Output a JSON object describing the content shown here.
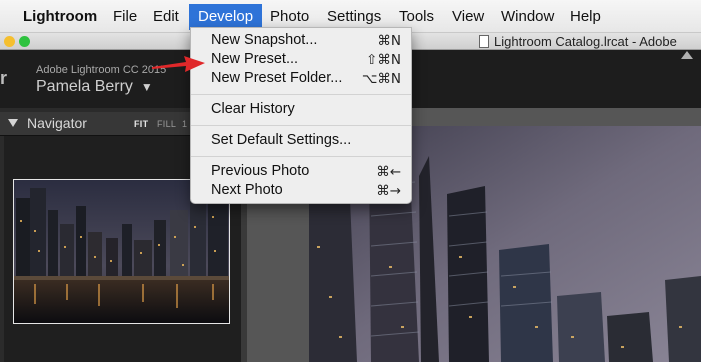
{
  "menubar": {
    "items": [
      {
        "label": "Lightroom"
      },
      {
        "label": "File"
      },
      {
        "label": "Edit"
      },
      {
        "label": "Develop"
      },
      {
        "label": "Photo"
      },
      {
        "label": "Settings"
      },
      {
        "label": "Tools"
      },
      {
        "label": "View"
      },
      {
        "label": "Window"
      },
      {
        "label": "Help"
      }
    ],
    "active_menu": "Develop"
  },
  "window": {
    "title": "Lightroom Catalog.lrcat - Adobe"
  },
  "identity": {
    "product": "Adobe Lightroom CC 2015",
    "user": "Pamela Berry",
    "user_chevron": "▼"
  },
  "navigator": {
    "title": "Navigator",
    "zoom_options": [
      "FIT",
      "FILL",
      "1"
    ],
    "selected_zoom": "FIT"
  },
  "develop_menu": {
    "items": [
      {
        "label": "New Snapshot...",
        "shortcut": "⌘N"
      },
      {
        "label": "New Preset...",
        "shortcut": "⇧⌘N"
      },
      {
        "label": "New Preset Folder...",
        "shortcut": "⌥⌘N"
      },
      {
        "label": "Clear History",
        "shortcut": ""
      },
      {
        "label": "Set Default Settings...",
        "shortcut": ""
      },
      {
        "label": "Previous Photo",
        "shortcut": "⌘←"
      },
      {
        "label": "Next Photo",
        "shortcut": "⌘→"
      }
    ]
  },
  "colors": {
    "menu_highlight": "#2e73d8",
    "annotation_arrow": "#e0282a",
    "traffic_yellow": "#f5bf2f",
    "traffic_green": "#2ec23f"
  },
  "icons": {
    "annotation": "red-arrow-icon",
    "panel_toggle": "triangle-down-icon",
    "document": "document-icon"
  }
}
